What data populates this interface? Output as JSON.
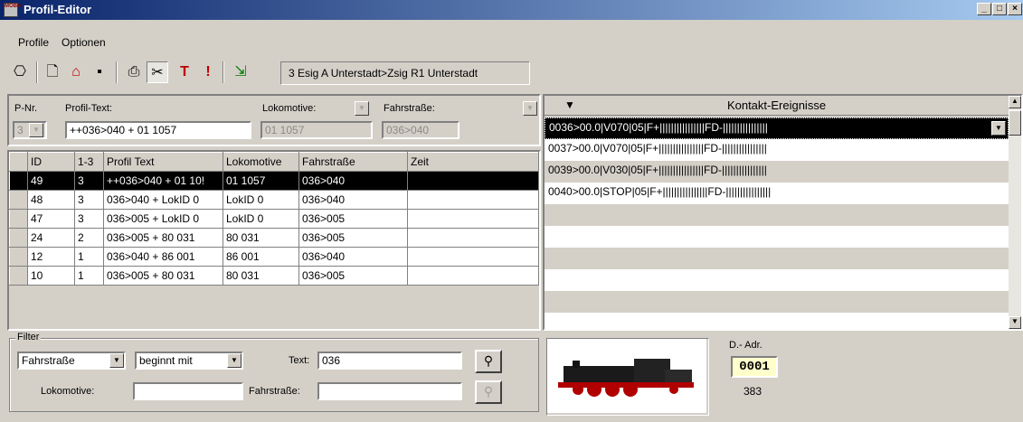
{
  "window": {
    "title": "Profil-Editor",
    "app_icon_text": "MOBA"
  },
  "menu": [
    "Profile",
    "Optionen"
  ],
  "toolbar": {
    "route_label": "3 Esig A Unterstadt>Zsig R1 Unterstadt",
    "icons": [
      "network-icon",
      "new-document-icon",
      "delete-icon",
      "save-icon",
      "print-icon",
      "cut-icon",
      "tool-icon",
      "warning-icon",
      "exit-icon"
    ]
  },
  "profile": {
    "pnr_label": "P-Nr.",
    "pnr_value": "3",
    "text_label": "Profil-Text:",
    "text_value": "++036>040 + 01 1057",
    "loco_label": "Lokomotive:",
    "loco_value": "01 1057",
    "route_label": "Fahrstraße:",
    "route_value": "036>040"
  },
  "table": {
    "columns": [
      "ID",
      "1-3",
      "Profil Text",
      "Lokomotive",
      "Fahrstraße",
      "Zeit"
    ],
    "rows": [
      [
        "49",
        "3",
        "++036>040 + 01 10!",
        "01 1057",
        "036>040",
        ""
      ],
      [
        "48",
        "3",
        "036>040 + LokID 0",
        "LokID 0",
        "036>040",
        ""
      ],
      [
        "47",
        "3",
        "036>005 + LokID 0",
        "LokID 0",
        "036>005",
        ""
      ],
      [
        "24",
        "2",
        "036>005 + 80 031",
        "80 031",
        "036>005",
        ""
      ],
      [
        "12",
        "1",
        "036>040 + 86 001",
        "86 001",
        "036>040",
        ""
      ],
      [
        "10",
        "1",
        "036>005 + 80 031",
        "80 031",
        "036>005",
        ""
      ]
    ]
  },
  "events": {
    "header": "Kontakt-Ereignisse",
    "items": [
      "0036>00.0|V070|05|F+||||||||||||||||FD-||||||||||||||||",
      "0037>00.0|V070|05|F+||||||||||||||||FD-||||||||||||||||",
      "0039>00.0|V030|05|F+||||||||||||||||FD-||||||||||||||||",
      "0040>00.0|STOP|05|F+||||||||||||||||FD-||||||||||||||||"
    ]
  },
  "filter": {
    "group_label": "Filter",
    "field_value": "Fahrstraße",
    "mode_value": "beginnt mit",
    "text_label": "Text:",
    "text_value": "036",
    "loco_label": "Lokomotive:",
    "loco_value": "",
    "route_label": "Fahrstraße:",
    "route_value": ""
  },
  "loco_info": {
    "dadr_label": "D.- Adr.",
    "dadr_value": "0001",
    "number": "383"
  },
  "colors": {
    "titlebar_start": "#0a246a",
    "titlebar_end": "#a6caf0",
    "face": "#d4d0c8",
    "selection": "#000000"
  }
}
